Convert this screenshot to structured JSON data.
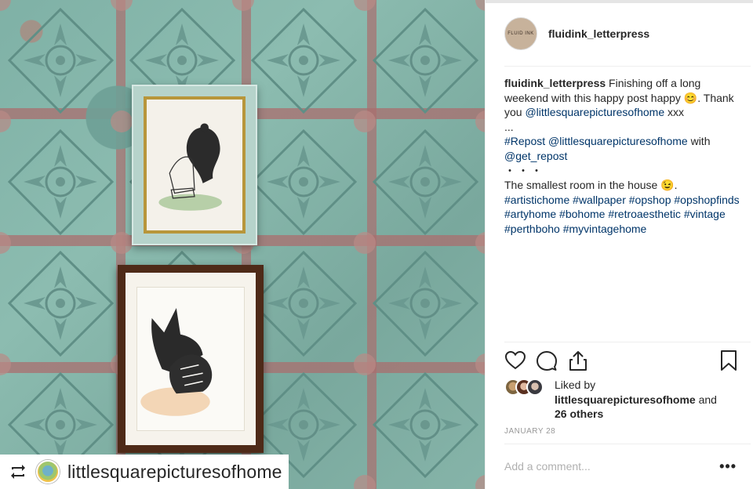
{
  "repost": {
    "username": "littlesquarepicturesofhome",
    "icon": "repost-icon"
  },
  "post": {
    "author": "fluidink_letterpress",
    "avatar_text": "FLUID INK",
    "caption": {
      "line1_text": "Finishing off a long weekend with this happy post happy 😊. Thank you",
      "mention1": "@littlesquarepicturesofhome",
      "line1_tail": " xxx",
      "ellipsis": "...",
      "repost_tag": "#Repost",
      "mention2": "@littlesquarepicturesofhome",
      "with_text": " with",
      "mention3": "@get_repost",
      "dots": "・・・",
      "body": "The smallest room in the house 😉.",
      "hashtags": [
        "#artistichome",
        "#wallpaper",
        "#opshop",
        "#opshopfinds",
        "#artyhome",
        "#bohome",
        "#retroaesthetic",
        "#vintage",
        "#perthboho",
        "#myvintagehome"
      ]
    },
    "liked_by_prefix": "Liked by",
    "liked_by_user": "littlesquarepicturesofhome",
    "liked_by_and": "and",
    "liked_by_others": "26 others",
    "date": "JANUARY 28",
    "comment_placeholder": "Add a comment...",
    "more_label": "•••"
  },
  "colors": {
    "link": "#003569",
    "text": "#262626",
    "muted": "#999999"
  }
}
